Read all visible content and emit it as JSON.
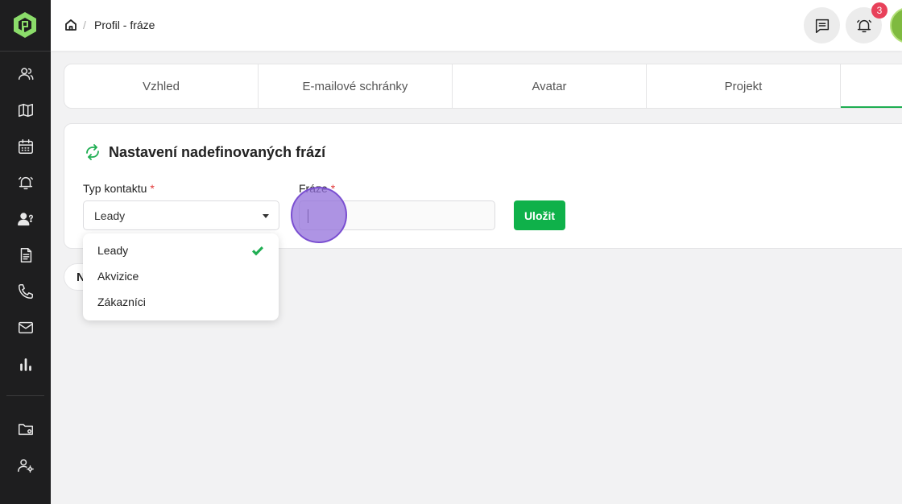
{
  "breadcrumb": {
    "separator": "/",
    "current": "Profil - fráze"
  },
  "header": {
    "notification_count": "3"
  },
  "colors": {
    "brand_green": "#1fae52",
    "sidebar_bg": "#1e1e1f",
    "badge_red": "#e8415a",
    "click_indicator": "#9370db"
  },
  "sidebar": {
    "logo": "brand-logo",
    "items": [
      {
        "icon": "users-icon"
      },
      {
        "icon": "map-icon"
      },
      {
        "icon": "calendar-icon"
      },
      {
        "icon": "alarm-bell-icon"
      },
      {
        "icon": "user-question-icon"
      },
      {
        "icon": "document-icon"
      },
      {
        "icon": "phone-icon"
      },
      {
        "icon": "mail-icon"
      },
      {
        "icon": "bar-chart-icon"
      },
      {
        "icon": "folder-settings-icon"
      },
      {
        "icon": "user-settings-icon"
      }
    ]
  },
  "tabs": [
    {
      "label": "Vzhled"
    },
    {
      "label": "E-mailové schránky"
    },
    {
      "label": "Avatar"
    },
    {
      "label": "Projekt"
    },
    {
      "label": ""
    }
  ],
  "card": {
    "title": "Nastavení nadefinovaných frází",
    "contact_type_label": "Typ kontaktu",
    "required_mark": "*",
    "contact_type_value": "Leady",
    "phrase_label": "Fráze",
    "phrase_value": "",
    "save_label": "Uložit"
  },
  "pill": {
    "text": "N"
  },
  "dropdown": {
    "options": [
      {
        "label": "Leady",
        "selected": true
      },
      {
        "label": "Akvizice",
        "selected": false
      },
      {
        "label": "Zákazníci",
        "selected": false
      }
    ]
  }
}
